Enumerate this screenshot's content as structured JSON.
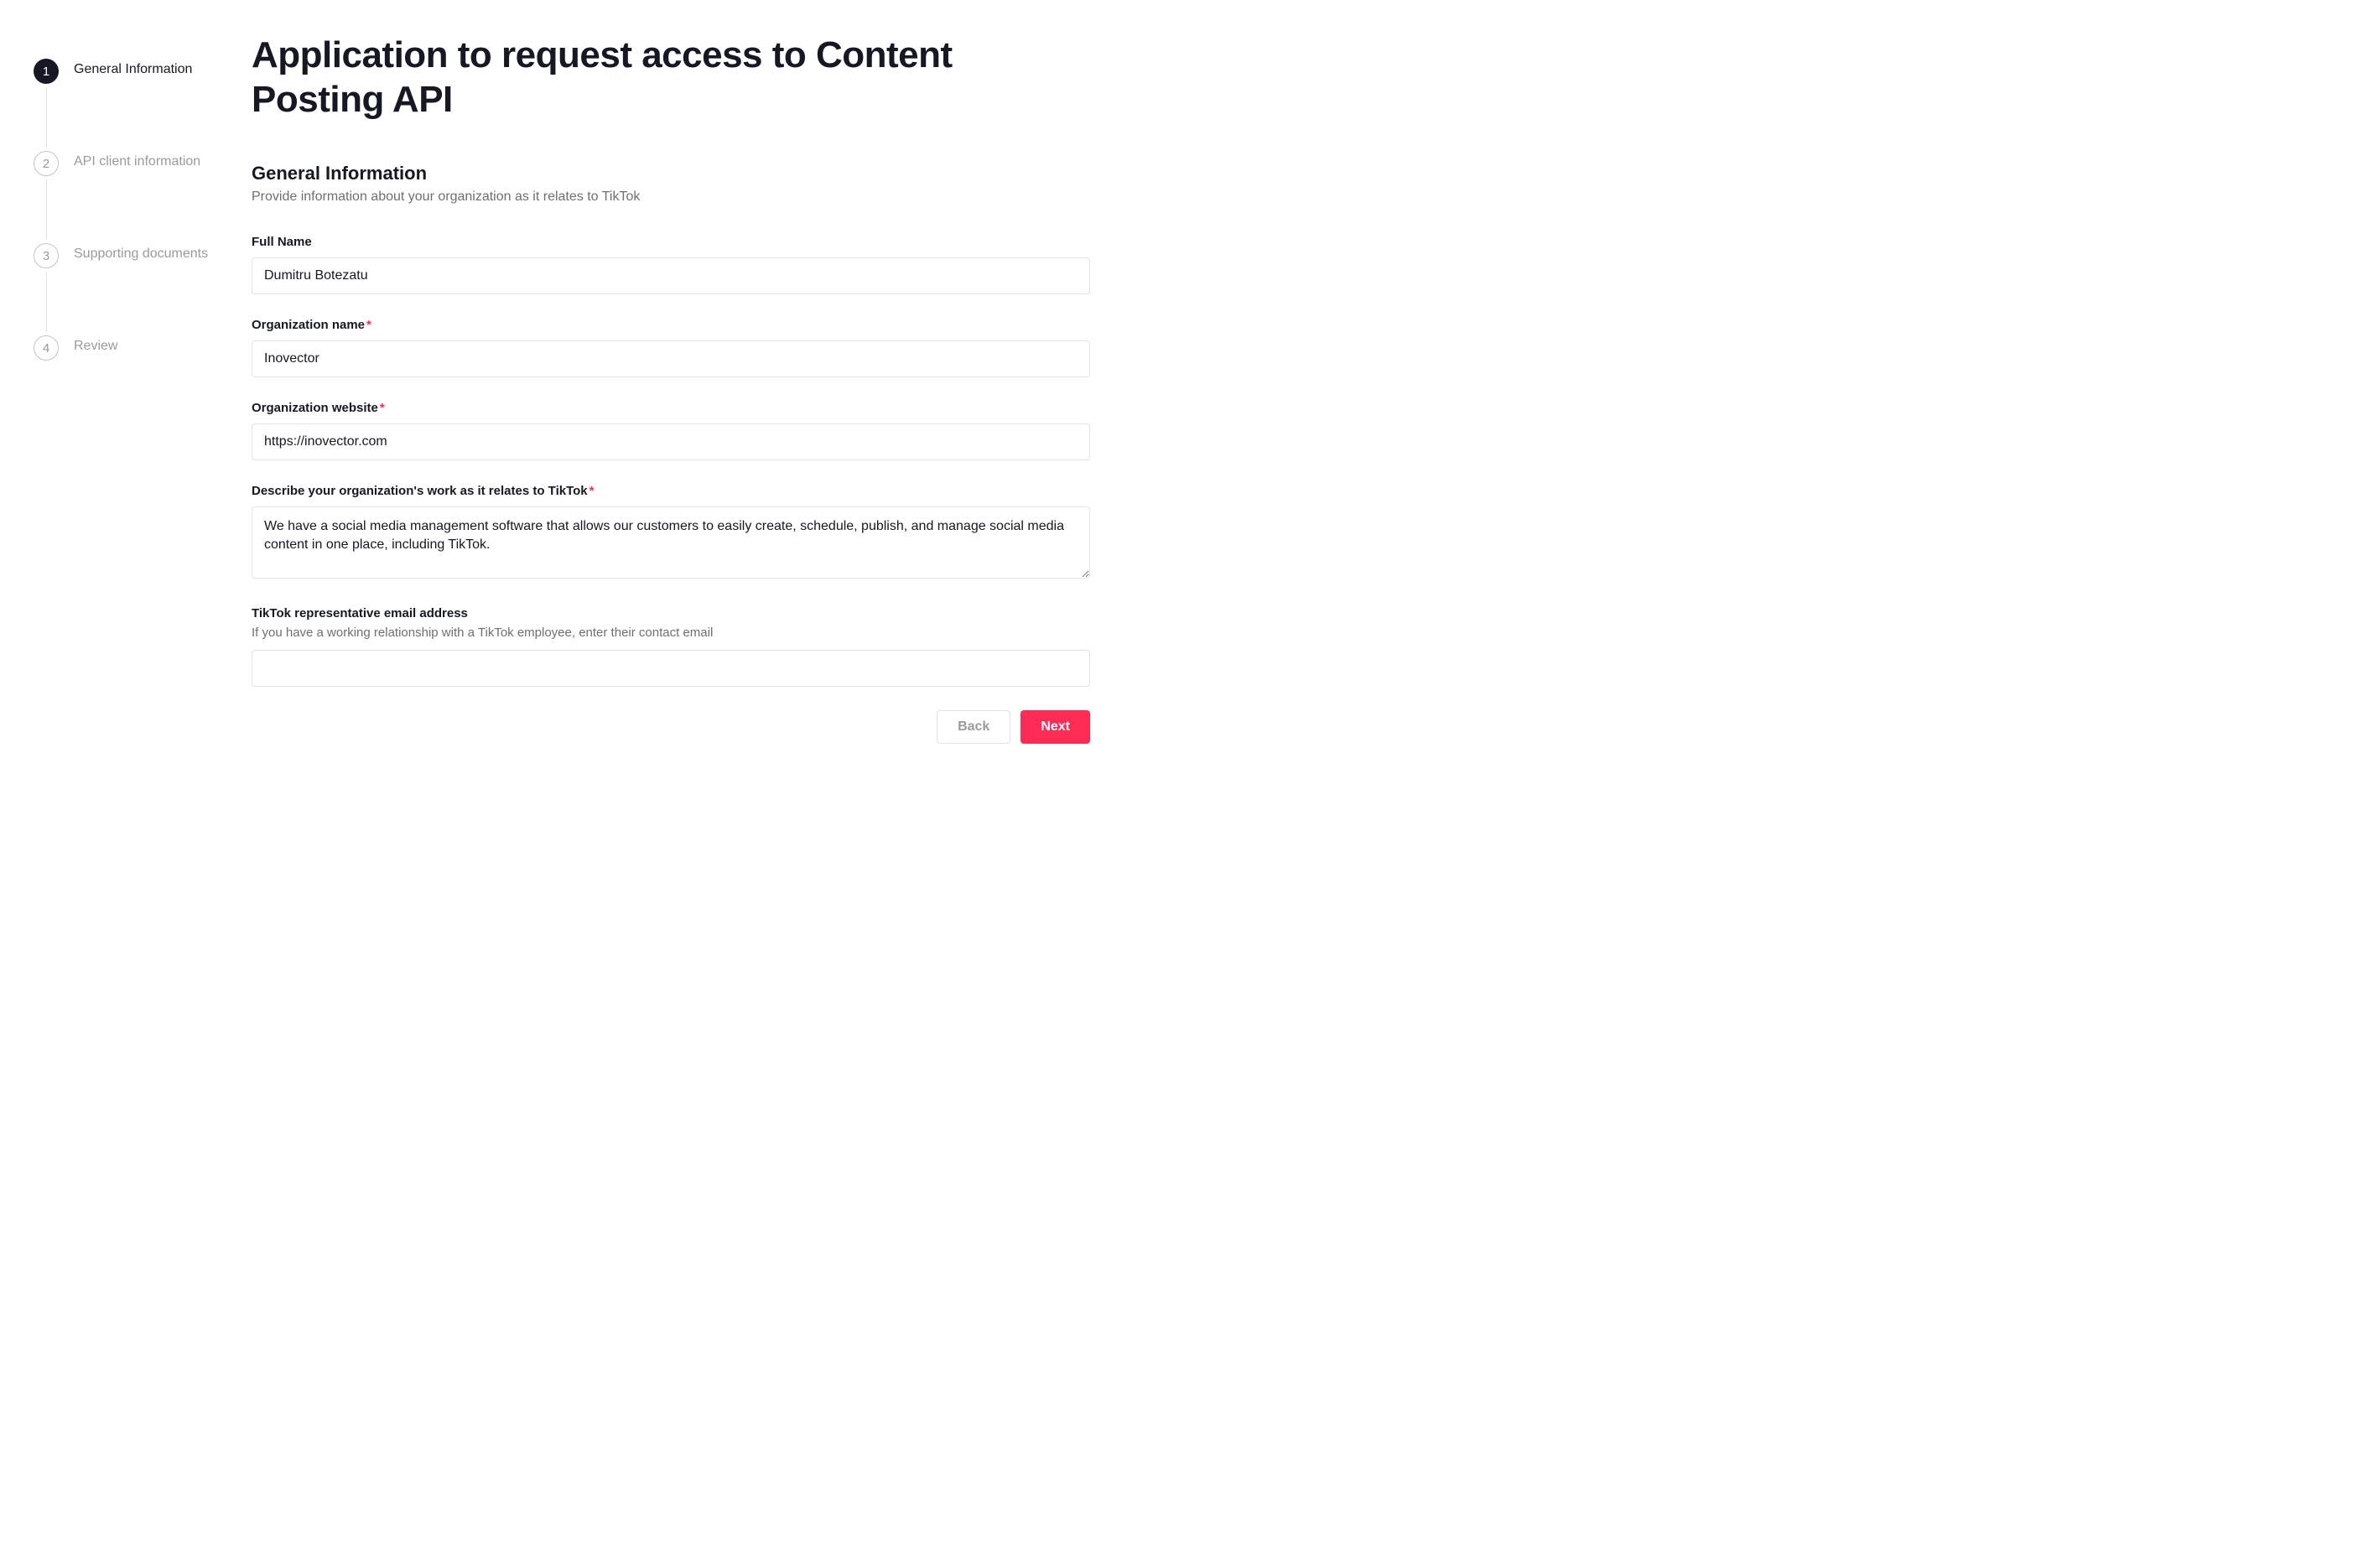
{
  "page_title": "Application to request access to Content Posting API",
  "steps": [
    {
      "number": "1",
      "label": "General Information",
      "active": true
    },
    {
      "number": "2",
      "label": "API client information",
      "active": false
    },
    {
      "number": "3",
      "label": "Supporting documents",
      "active": false
    },
    {
      "number": "4",
      "label": "Review",
      "active": false
    }
  ],
  "section": {
    "title": "General Information",
    "subtitle": "Provide information about your organization as it relates to TikTok"
  },
  "fields": {
    "full_name": {
      "label": "Full Name",
      "value": "Dumitru Botezatu"
    },
    "org_name": {
      "label": "Organization name",
      "value": "Inovector"
    },
    "org_website": {
      "label": "Organization website",
      "value": "https://inovector.com"
    },
    "org_description": {
      "label": "Describe your organization's work as it relates to TikTok",
      "value": "We have a social media management software that allows our customers to easily create, schedule, publish, and manage social media content in one place, including TikTok."
    },
    "tiktok_rep": {
      "label": "TikTok representative email address",
      "help": "If you have a working relationship with a TikTok employee, enter their contact email",
      "value": ""
    }
  },
  "required_marker": "*",
  "buttons": {
    "back": "Back",
    "next": "Next"
  }
}
